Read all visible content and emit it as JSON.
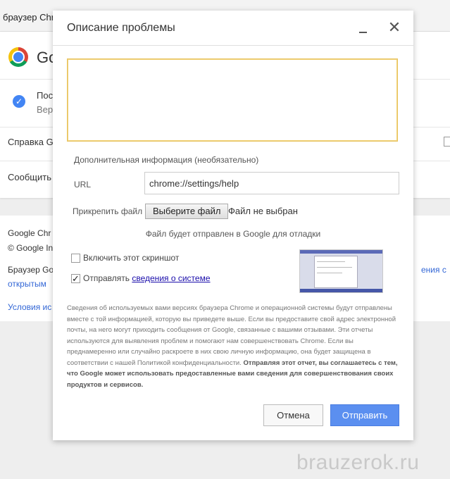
{
  "background": {
    "tab_title": "браузер Chrome",
    "app_title_fragment": "Go",
    "status_line1": "Пос",
    "status_line2": "Вер",
    "help_item": "Справка G",
    "report_item": "Сообщить",
    "footer_line1": "Google Chr",
    "footer_line2": "© Google In",
    "footer_line3": "Браузер Go",
    "footer_line3_right": "ения с",
    "footer_line4": "открытым",
    "terms_link": "Условия ис"
  },
  "dialog": {
    "title": "Описание проблемы",
    "description_value": "",
    "additional_info_label": "Дополнительная информация (необязательно)",
    "url_label": "URL",
    "url_value": "chrome://settings/help",
    "attach_label": "Прикрепить файл",
    "choose_file_label": "Выберите файл",
    "file_status": "Файл не выбран",
    "file_note": "Файл будет отправлен в Google для отладки",
    "screenshot_checkbox": {
      "label": "Включить этот скриншот",
      "checked": false
    },
    "system_checkbox": {
      "label_prefix": "Отправлять ",
      "link": "сведения о системе",
      "checked": true
    },
    "disclaimer_text": "Сведения об используемых вами версиях браузера Chrome и операционной системы будут отправлены вместе с той информацией, которую вы приведете выше. Если вы предоставите свой адрес электронной почты, на него могут приходить сообщения от Google, связанные с вашими отзывами. Эти отчеты используются для выявления проблем и помогают нам совершенствовать Chrome. Если вы преднамеренно или случайно раскроете в них свою личную информацию, она будет защищена в соответствии с нашей Политикой конфиденциальности. ",
    "disclaimer_bold": "Отправляя этот отчет, вы соглашаетесь с тем, что Google может использовать предоставленные вами сведения для совершенствования своих продуктов и сервисов.",
    "cancel_label": "Отмена",
    "send_label": "Отправить"
  },
  "watermark": "brauzerok.ru",
  "colors": {
    "accent": "#5b8ff0",
    "focus_border": "#e7c35f",
    "link": "#1a0dab"
  }
}
